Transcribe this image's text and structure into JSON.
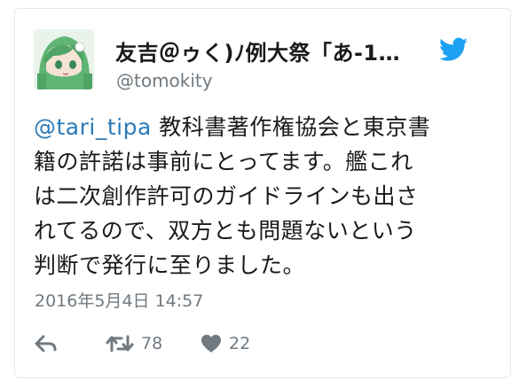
{
  "tweet": {
    "display_name": "友吉＠ゥく)ﾉ例大祭「あ-1…",
    "handle": "@tomokity",
    "mention": "@tari_tipa",
    "body_lines": [
      " 教科書著作権協会と東京書",
      "籍の許諾は事前にとってます。艦これ",
      "は二次創作許可のガイドラインも出さ",
      "れてるので、双方とも問題ないという",
      "判断で発行に至りました。"
    ],
    "timestamp": "2016年5月4日 14:57",
    "retweet_count": "78",
    "like_count": "22"
  },
  "icons": {
    "brand": "twitter-bird-icon",
    "reply": "reply-arrow-icon",
    "retweet": "retweet-icon",
    "like": "heart-icon"
  },
  "colors": {
    "link": "#2b7bb9",
    "brand": "#1da1f2",
    "muted": "#707980",
    "text": "#1a1a1a",
    "border": "#e1e8ed"
  }
}
